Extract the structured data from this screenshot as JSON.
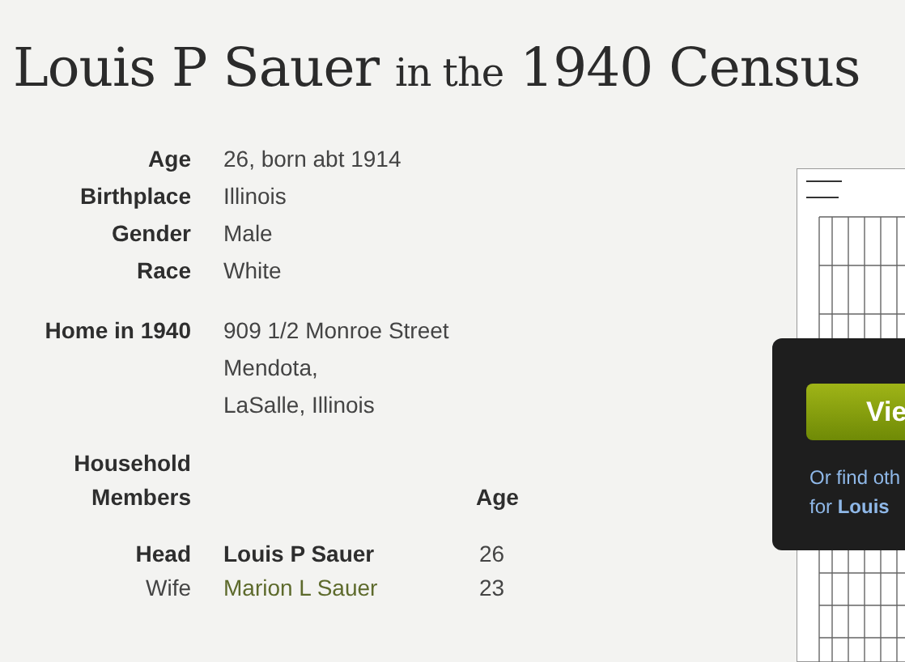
{
  "title": {
    "name": "Louis P Sauer",
    "connector": "in the",
    "rest": "1940 Census"
  },
  "facts": [
    {
      "label": "Age",
      "lines": [
        "26, born abt 1914"
      ]
    },
    {
      "label": "Birthplace",
      "lines": [
        "Illinois"
      ]
    },
    {
      "label": "Gender",
      "lines": [
        "Male"
      ]
    },
    {
      "label": "Race",
      "lines": [
        "White"
      ]
    },
    {
      "label": "Home in 1940",
      "lines": [
        "909 1/2 Monroe Street",
        "Mendota,",
        "LaSalle, Illinois"
      ],
      "spaced": true
    }
  ],
  "household": {
    "label": "Household Members",
    "age_header": "Age",
    "members": [
      {
        "relation": "Head",
        "name": "Louis P Sauer",
        "age": "26",
        "highlighted": true
      },
      {
        "relation": "Wife",
        "name": "Marion L Sauer",
        "age": "23",
        "highlighted": false
      }
    ]
  },
  "view_panel": {
    "button": "Vie",
    "text": "Or find oth",
    "text2": "for **Louis**"
  }
}
